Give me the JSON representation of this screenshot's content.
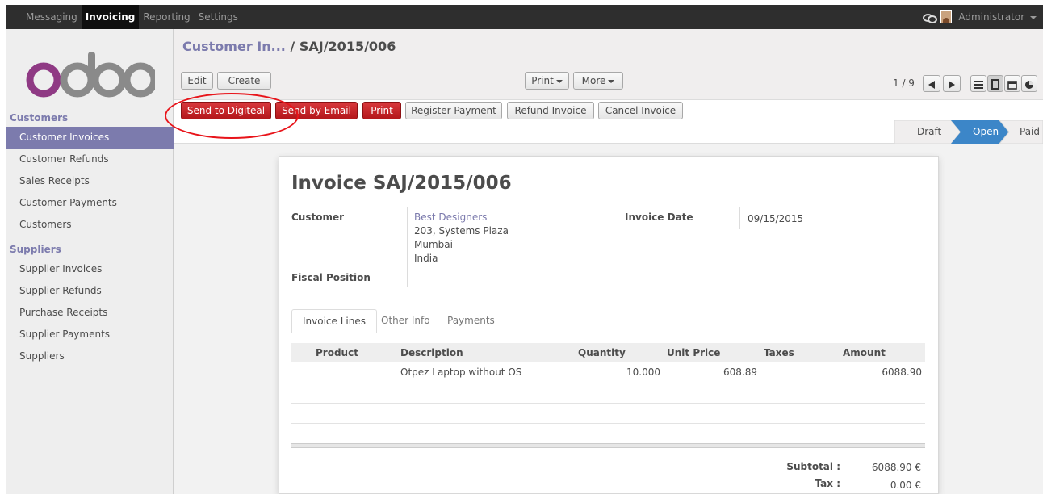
{
  "topbar": {
    "menus": [
      "Messaging",
      "Invoicing",
      "Reporting",
      "Settings"
    ],
    "active_menu": "Invoicing",
    "user": "Administrator"
  },
  "sidebar": {
    "logo_text": "odoo",
    "sections": [
      {
        "title": "Customers",
        "items": [
          "Customer Invoices",
          "Customer Refunds",
          "Sales Receipts",
          "Customer Payments",
          "Customers"
        ]
      },
      {
        "title": "Suppliers",
        "items": [
          "Supplier Invoices",
          "Supplier Refunds",
          "Purchase Receipts",
          "Supplier Payments",
          "Suppliers"
        ]
      }
    ],
    "active_item": "Customer Invoices"
  },
  "breadcrumb": {
    "parent": "Customer In...",
    "separator": " / ",
    "current": "SAJ/2015/006"
  },
  "toolbar": {
    "edit": "Edit",
    "create": "Create",
    "print": "Print",
    "more": "More"
  },
  "pager": {
    "value": "1 / 9"
  },
  "actions": {
    "send_digiteal": "Send to Digiteal",
    "send_email": "Send by Email",
    "print": "Print",
    "register_payment": "Register Payment",
    "refund_invoice": "Refund Invoice",
    "cancel_invoice": "Cancel Invoice"
  },
  "status": {
    "stages": [
      "Draft",
      "Open",
      "Paid"
    ],
    "active": "Open"
  },
  "invoice": {
    "title": "Invoice SAJ/2015/006",
    "customer_label": "Customer",
    "customer_name": "Best Designers",
    "address1": "203, Systems Plaza",
    "address2": "Mumbai",
    "address3": "India",
    "fiscal_label": "Fiscal Position",
    "date_label": "Invoice Date",
    "date_value": "09/15/2015"
  },
  "tabs": [
    "Invoice Lines",
    "Other Info",
    "Payments"
  ],
  "lines": {
    "headers": [
      "Product",
      "Description",
      "Quantity",
      "Unit Price",
      "Taxes",
      "Amount"
    ],
    "rows": [
      {
        "product": "",
        "description": "Otpez Laptop without OS",
        "quantity": "10.000",
        "unit_price": "608.89",
        "taxes": "",
        "amount": "6088.90"
      }
    ]
  },
  "totals": {
    "subtotal_label": "Subtotal :",
    "subtotal": "6088.90 €",
    "tax_label": "Tax :",
    "tax": "0.00 €"
  },
  "colors": {
    "brand": "#7c7bad",
    "danger": "#c0252a",
    "annotation": "#e8141a"
  }
}
